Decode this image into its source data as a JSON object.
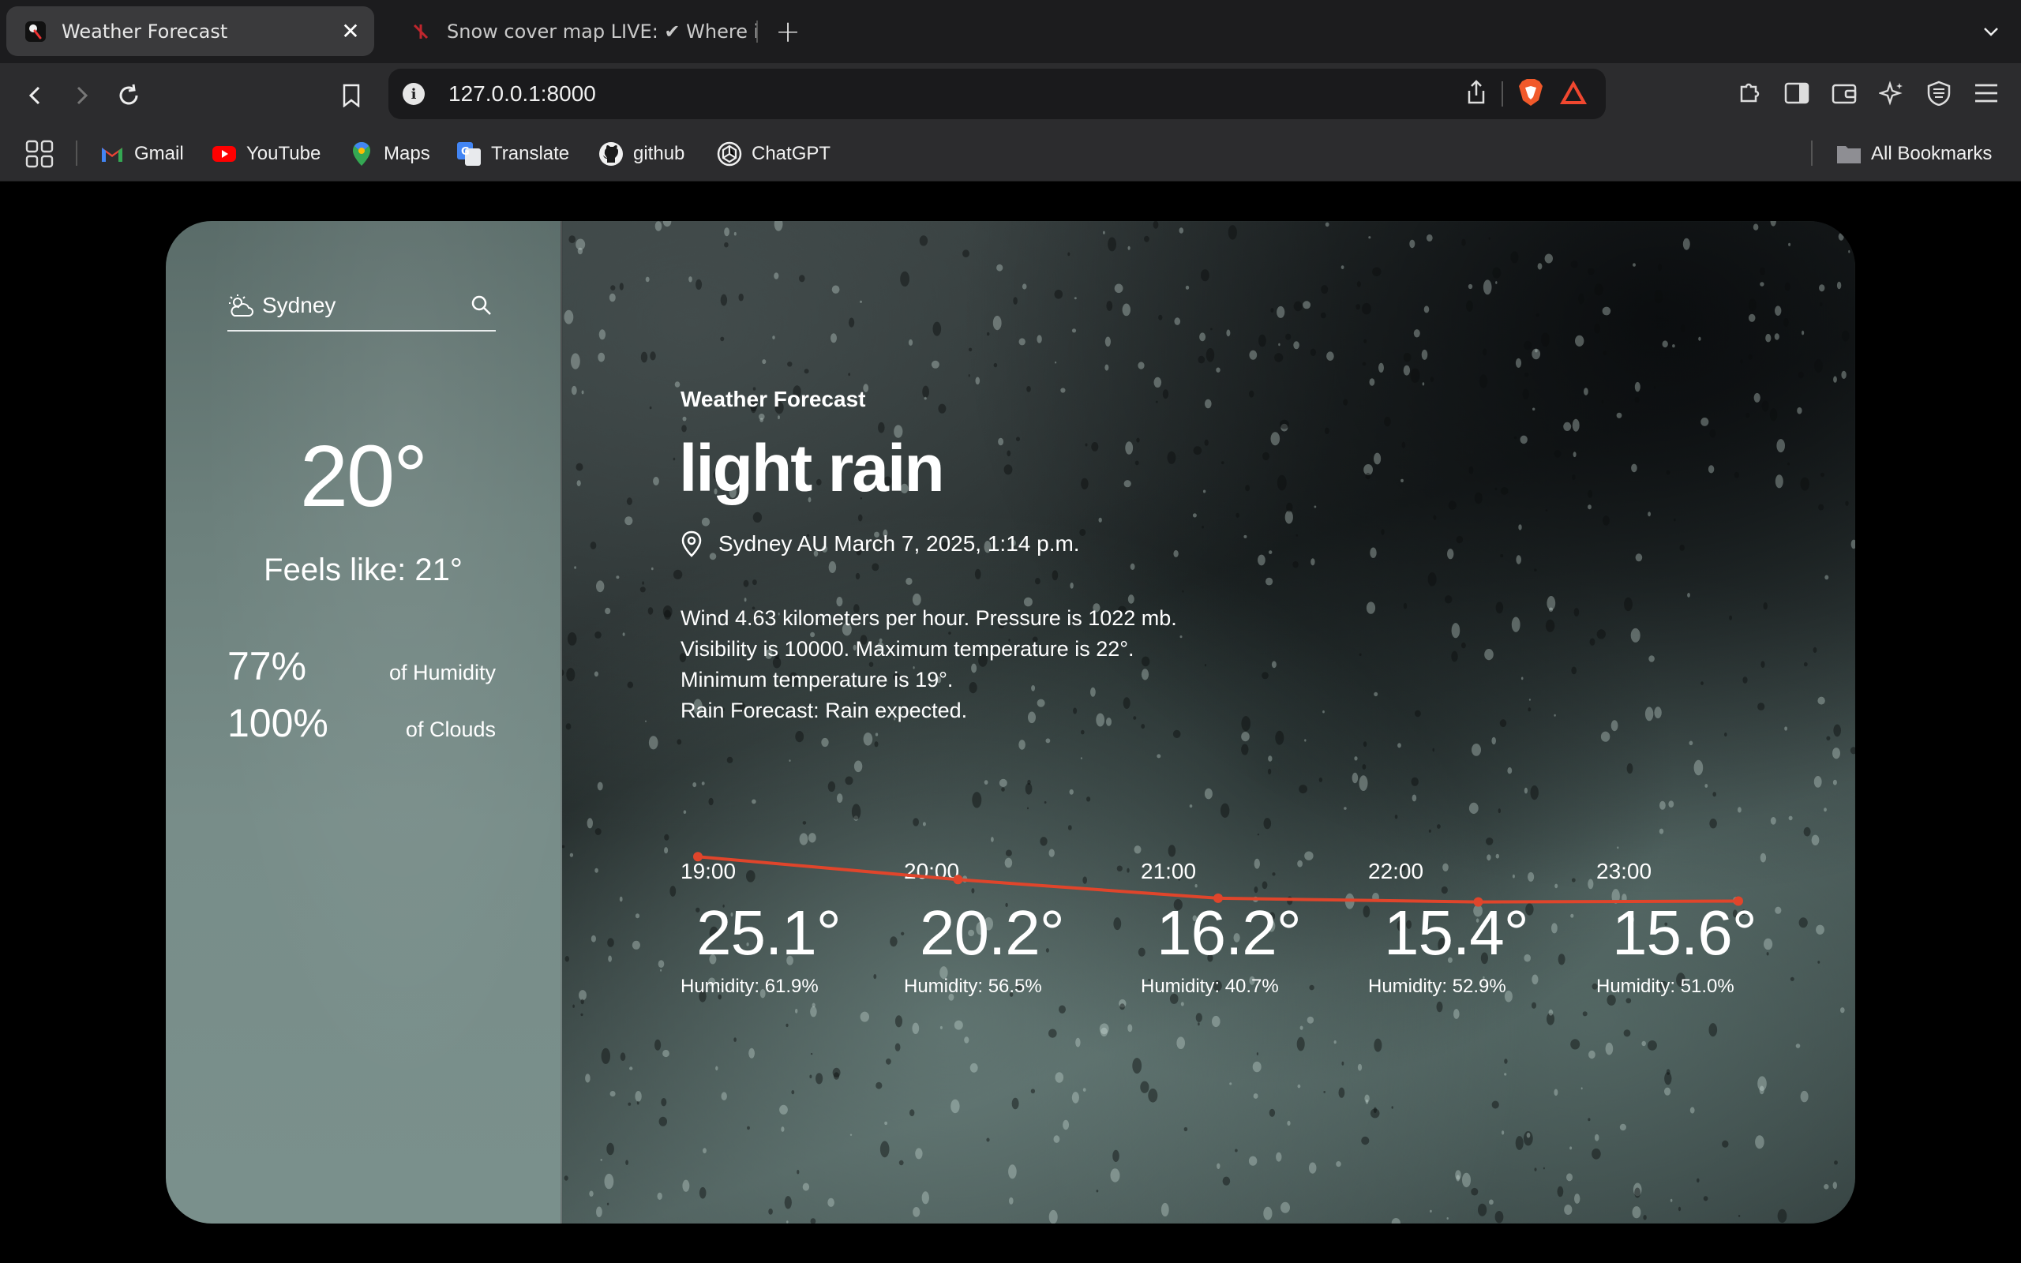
{
  "browser": {
    "tabs": [
      {
        "title": "Weather Forecast",
        "active": true
      },
      {
        "title": "Snow cover map LIVE: ✔ Where i",
        "active": false
      }
    ],
    "url": "127.0.0.1:8000",
    "bookmarks": [
      {
        "label": "Gmail",
        "icon": "gmail-icon"
      },
      {
        "label": "YouTube",
        "icon": "youtube-icon"
      },
      {
        "label": "Maps",
        "icon": "maps-icon"
      },
      {
        "label": "Translate",
        "icon": "translate-icon"
      },
      {
        "label": "github",
        "icon": "github-icon"
      },
      {
        "label": "ChatGPT",
        "icon": "chatgpt-icon"
      }
    ],
    "all_bookmarks": "All Bookmarks"
  },
  "sidebar": {
    "city": "Sydney",
    "temperature": "20°",
    "feels_like": "Feels like:  21°",
    "humidity_value": "77%",
    "humidity_label": "of Humidity",
    "clouds_value": "100%",
    "clouds_label": "of Clouds"
  },
  "main": {
    "label": "Weather Forecast",
    "condition": "light rain",
    "location": "Sydney AU March 7, 2025, 1:14 p.m.",
    "description": [
      "Wind 4.63 kilometers per hour. Pressure is 1022 mb.",
      "Visibility is 10000. Maximum temperature is 22°.",
      "Minimum temperature is 19°.",
      "Rain Forecast: Rain expected."
    ],
    "forecast": [
      {
        "time": "19:00",
        "temp": "25.1°",
        "humidity": "Humidity: 61.9%",
        "value": 25.1
      },
      {
        "time": "20:00",
        "temp": "20.2°",
        "humidity": "Humidity: 56.5%",
        "value": 20.2
      },
      {
        "time": "21:00",
        "temp": "16.2°",
        "humidity": "Humidity: 40.7%",
        "value": 16.2
      },
      {
        "time": "22:00",
        "temp": "15.4°",
        "humidity": "Humidity: 52.9%",
        "value": 15.4
      },
      {
        "time": "23:00",
        "temp": "15.6°",
        "humidity": "Humidity: 51.0%",
        "value": 15.6
      }
    ],
    "trend_color": "#e0452b"
  },
  "colors": {
    "sidebar": "#6c807c",
    "accent_line": "#e0452b"
  }
}
